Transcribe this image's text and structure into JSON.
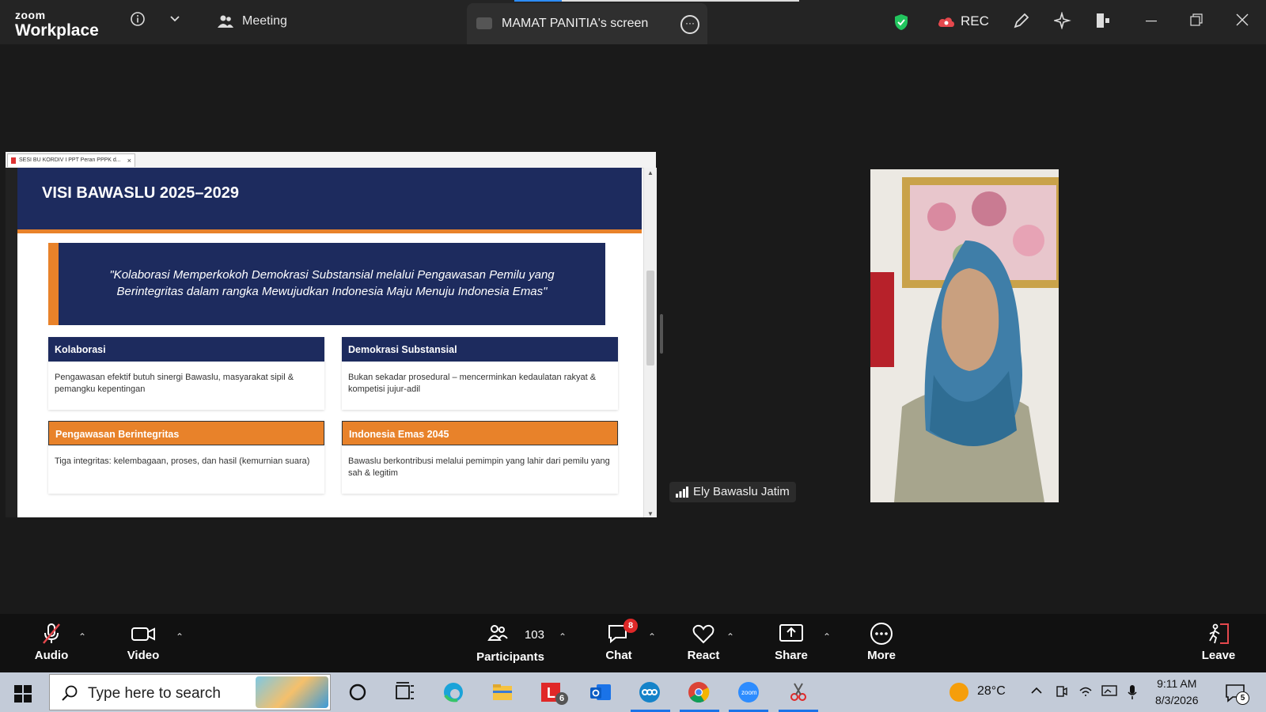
{
  "app": {
    "brand_top": "zoom",
    "brand_bottom": "Workplace",
    "meeting_label": "Meeting",
    "screen_label": "MAMAT PANITIA's screen",
    "rec_label": "REC"
  },
  "share": {
    "tab_title": "SESI BU KORDIV I PPT Peran PPPK d...",
    "slide_title": "VISI BAWASLU 2025–2029",
    "quote": "\"Kolaborasi Memperkokoh Demokrasi Substansial melalui Pengawasan Pemilu yang Berintegritas dalam rangka Mewujudkan Indonesia Maju Menuju Indonesia Emas\"",
    "cards": [
      {
        "title": "Kolaborasi",
        "body": "Pengawasan efektif butuh sinergi Bawaslu, masyarakat sipil & pemangku kepentingan"
      },
      {
        "title": "Demokrasi Substansial",
        "body": "Bukan sekadar prosedural – mencerminkan kedaulatan rakyat & kompetisi jujur-adil"
      },
      {
        "title": "Pengawasan Berintegritas",
        "body": "Tiga integritas: kelembagaan, proses, dan hasil (kemurnian suara)"
      },
      {
        "title": "Indonesia Emas 2045",
        "body": "Bawaslu berkontribusi melalui pemimpin yang lahir dari pemilu yang sah & legitim"
      }
    ],
    "colors": {
      "navy": "#1d2b5e",
      "orange": "#e8822a"
    }
  },
  "participant": {
    "name": "Ely Bawaslu Jatim"
  },
  "controls": {
    "audio": "Audio",
    "video": "Video",
    "participants": "Participants",
    "participants_count": "103",
    "chat": "Chat",
    "chat_badge": "8",
    "react": "React",
    "share": "Share",
    "more": "More",
    "leave": "Leave"
  },
  "taskbar": {
    "search_placeholder": "Type here to search",
    "mail_badge": "6",
    "temperature": "28°C",
    "time": "9:11 AM",
    "date": "8/3/2026",
    "notifications": "5"
  }
}
